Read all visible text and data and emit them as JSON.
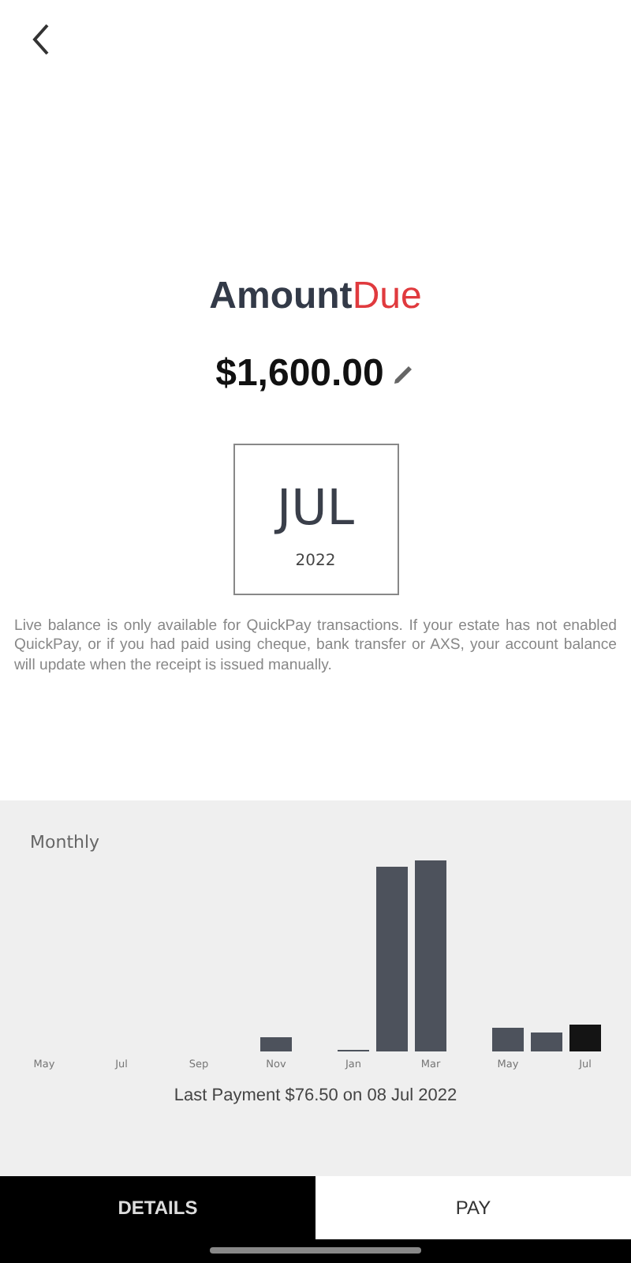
{
  "title": {
    "first": "Amount",
    "second": "Due"
  },
  "amount": "$1,600.00",
  "period": {
    "month": "JUL",
    "year": "2022"
  },
  "notice": "Live balance is only available for QuickPay transactions. If your estate has not enabled QuickPay, or if you had paid using cheque, bank transfer or AXS, your account balance will update when the receipt is issued manually.",
  "chart": {
    "title": "Monthly",
    "month_labels": [
      "May",
      "Jul",
      "Sep",
      "Nov",
      "Jan",
      "Mar",
      "May",
      "Jul"
    ]
  },
  "last_payment": "Last Payment $76.50 on 08 Jul 2022",
  "tabs": [
    {
      "label": "DETAILS",
      "selected": true
    },
    {
      "label": "PAY",
      "selected": false
    }
  ]
}
